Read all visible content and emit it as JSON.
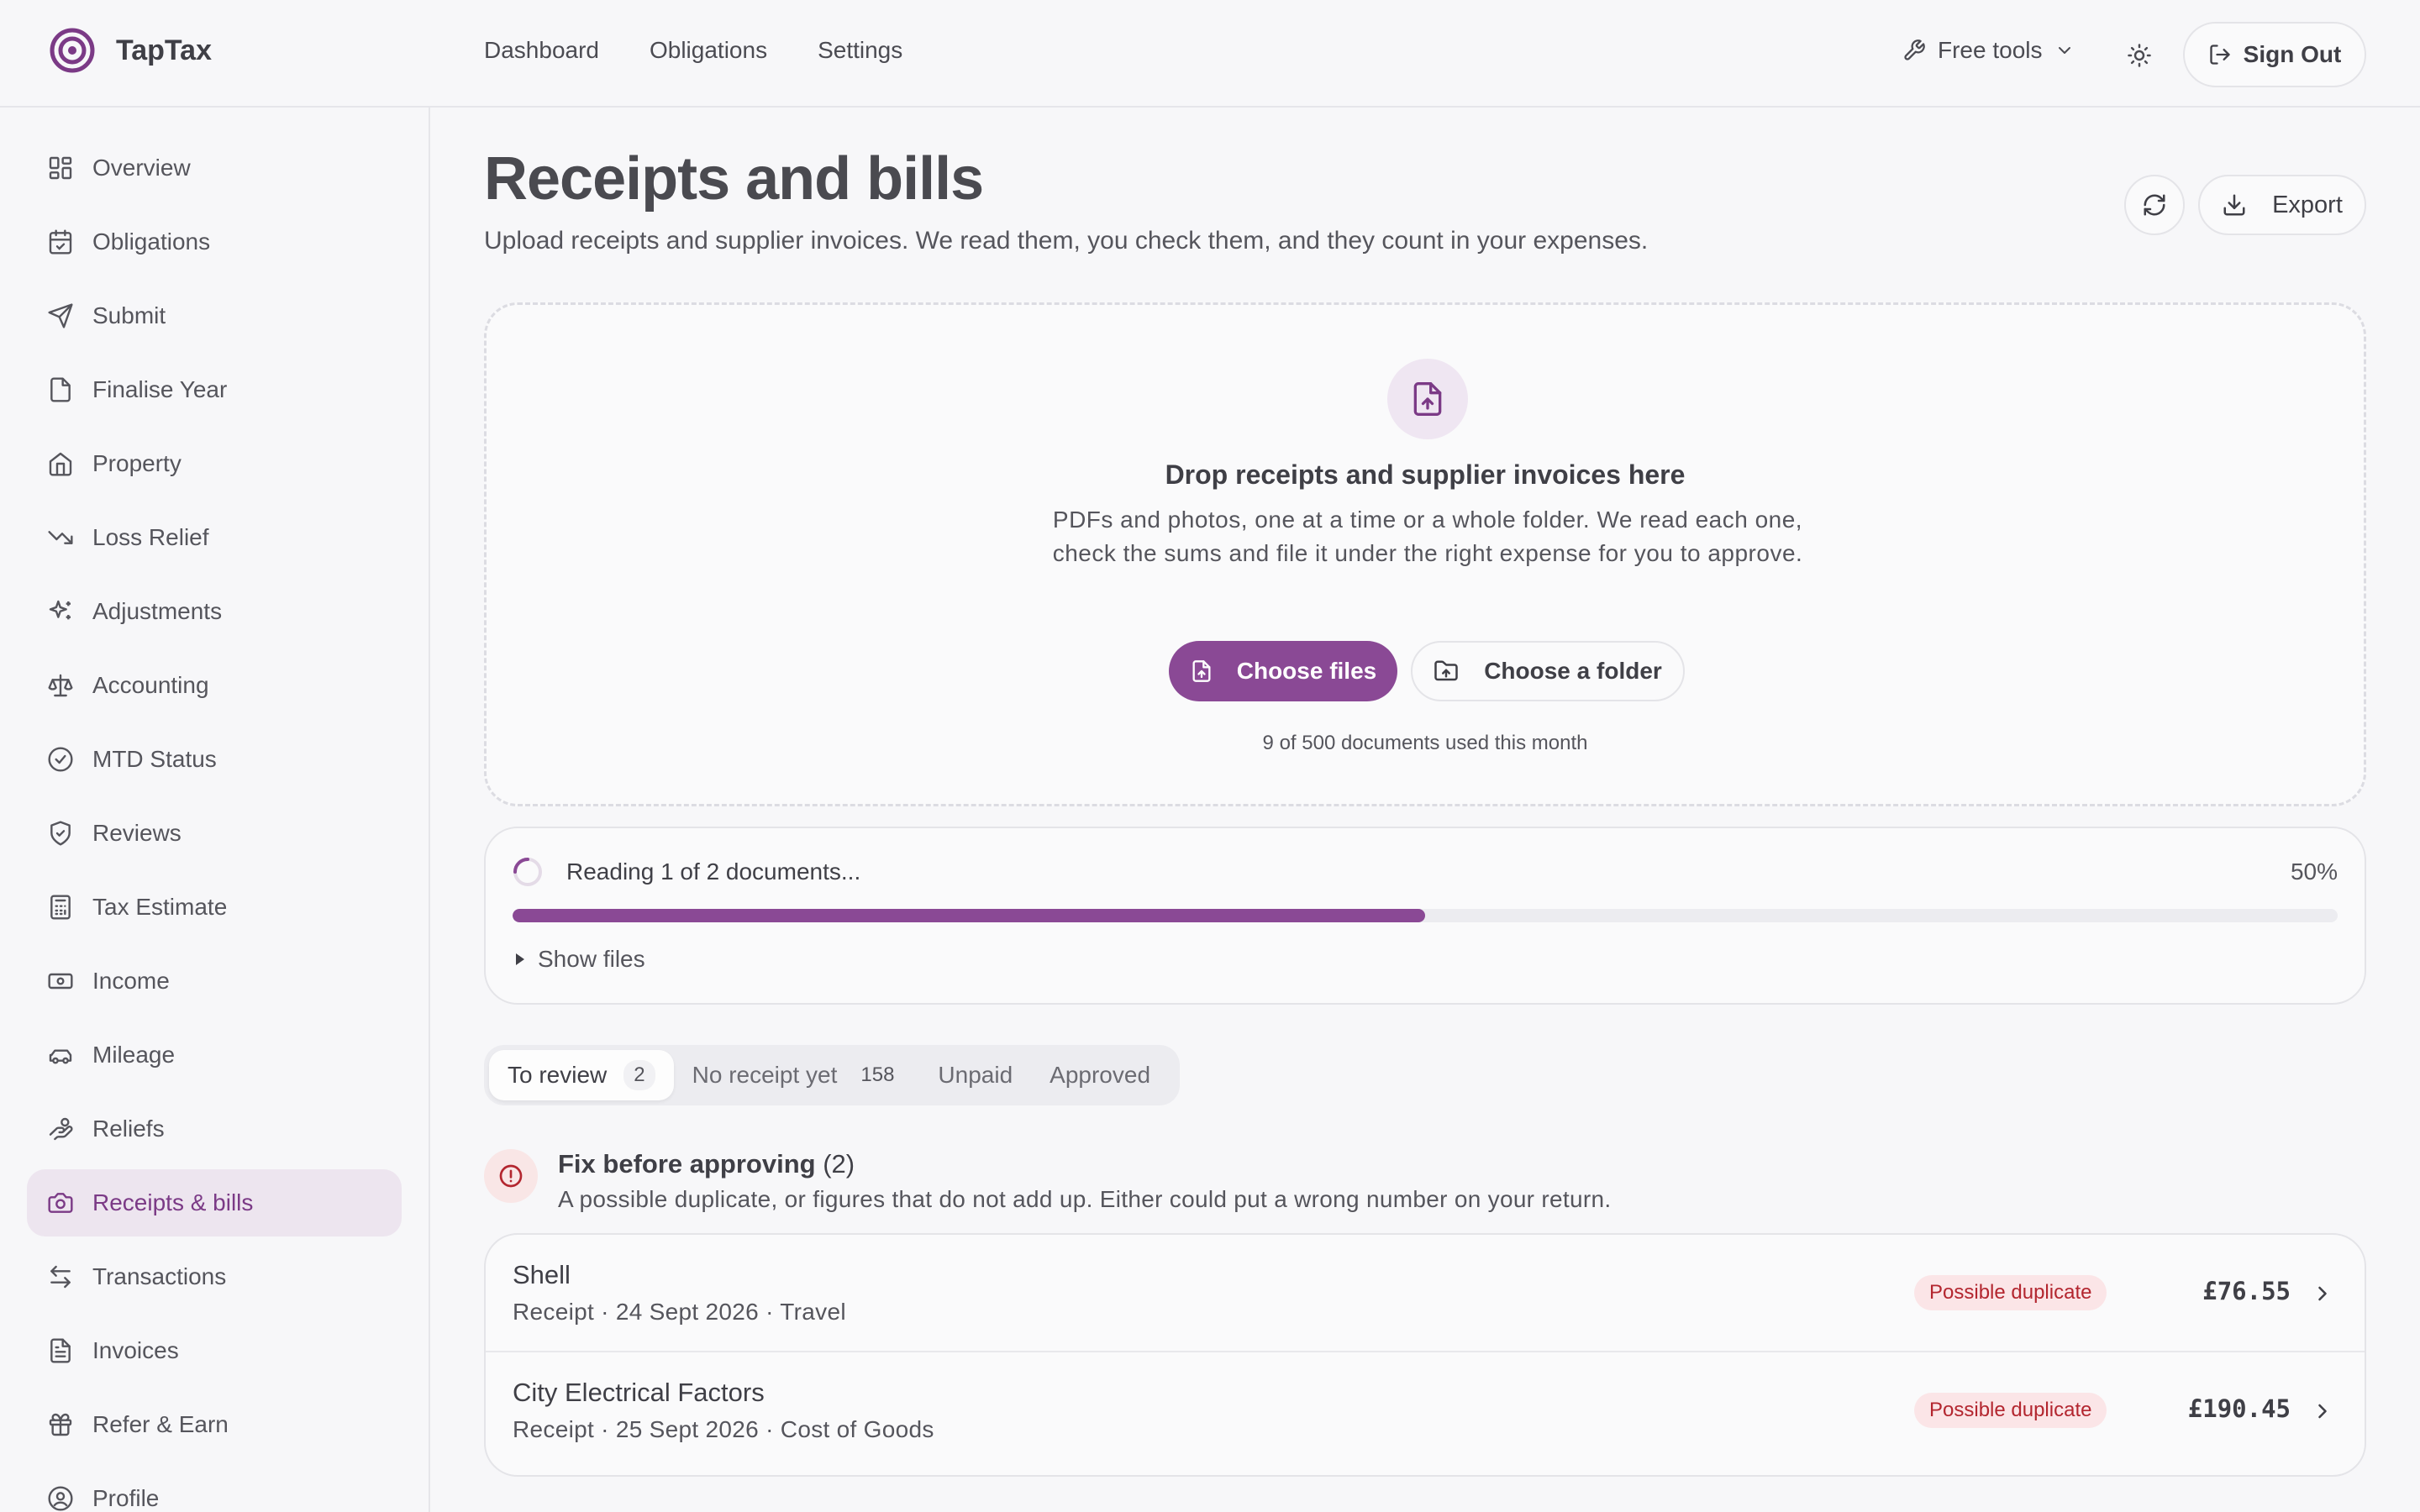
{
  "app": {
    "name": "TapTax"
  },
  "topnav": {
    "items": [
      {
        "label": "Dashboard"
      },
      {
        "label": "Obligations"
      },
      {
        "label": "Settings"
      }
    ],
    "free_tools": "Free tools",
    "sign_out": "Sign Out"
  },
  "sidebar": {
    "items": [
      {
        "label": "Overview",
        "icon": "grid-icon"
      },
      {
        "label": "Obligations",
        "icon": "calendar-check-icon"
      },
      {
        "label": "Submit",
        "icon": "send-icon"
      },
      {
        "label": "Finalise Year",
        "icon": "file-icon"
      },
      {
        "label": "Property",
        "icon": "home-icon"
      },
      {
        "label": "Loss Relief",
        "icon": "trending-down-icon"
      },
      {
        "label": "Adjustments",
        "icon": "sparkles-icon"
      },
      {
        "label": "Accounting",
        "icon": "scale-icon"
      },
      {
        "label": "MTD Status",
        "icon": "check-circle-icon"
      },
      {
        "label": "Reviews",
        "icon": "shield-check-icon"
      },
      {
        "label": "Tax Estimate",
        "icon": "calculator-icon"
      },
      {
        "label": "Income",
        "icon": "banknote-icon"
      },
      {
        "label": "Mileage",
        "icon": "car-icon"
      },
      {
        "label": "Reliefs",
        "icon": "hand-coins-icon"
      },
      {
        "label": "Receipts & bills",
        "icon": "camera-icon",
        "active": true
      },
      {
        "label": "Transactions",
        "icon": "arrow-left-right-icon"
      },
      {
        "label": "Invoices",
        "icon": "file-text-icon"
      },
      {
        "label": "Refer & Earn",
        "icon": "gift-icon"
      },
      {
        "label": "Profile",
        "icon": "user-circle-icon"
      }
    ]
  },
  "page": {
    "title": "Receipts and bills",
    "subtitle": "Upload receipts and supplier invoices. We read them, you check them, and they count in your expenses.",
    "export_label": "Export"
  },
  "dropzone": {
    "title": "Drop receipts and supplier invoices here",
    "description": "PDFs and photos, one at a time or a whole folder. We read each one, check the sums and file it under the right expense for you to approve.",
    "choose_files": "Choose files",
    "choose_folder": "Choose a folder",
    "usage": "9 of 500 documents used this month"
  },
  "progress": {
    "label": "Reading 1 of 2 documents...",
    "percent_label": "50%",
    "value": 0.5,
    "show_files": "Show files"
  },
  "tabs": [
    {
      "label": "To review",
      "count": "2",
      "active": true
    },
    {
      "label": "No receipt yet",
      "count": "158"
    },
    {
      "label": "Unpaid",
      "count": null
    },
    {
      "label": "Approved",
      "count": null
    }
  ],
  "fix_section": {
    "title": "Fix before approving",
    "count": "(2)",
    "description": "A possible duplicate, or figures that do not add up. Either could put a wrong number on your return."
  },
  "review_items": [
    {
      "name": "Shell",
      "meta": "Receipt · 24 Sept 2026 · Travel",
      "badge": "Possible duplicate",
      "amount": "£76.55"
    },
    {
      "name": "City Electrical Factors",
      "meta": "Receipt · 25 Sept 2026 · Cost of Goods",
      "badge": "Possible duplicate",
      "amount": "£190.45"
    }
  ],
  "colors": {
    "accent": "#8a4995",
    "accent_light": "#ede5ef",
    "danger": "#b3262f",
    "danger_bg": "#fbe5e7"
  }
}
